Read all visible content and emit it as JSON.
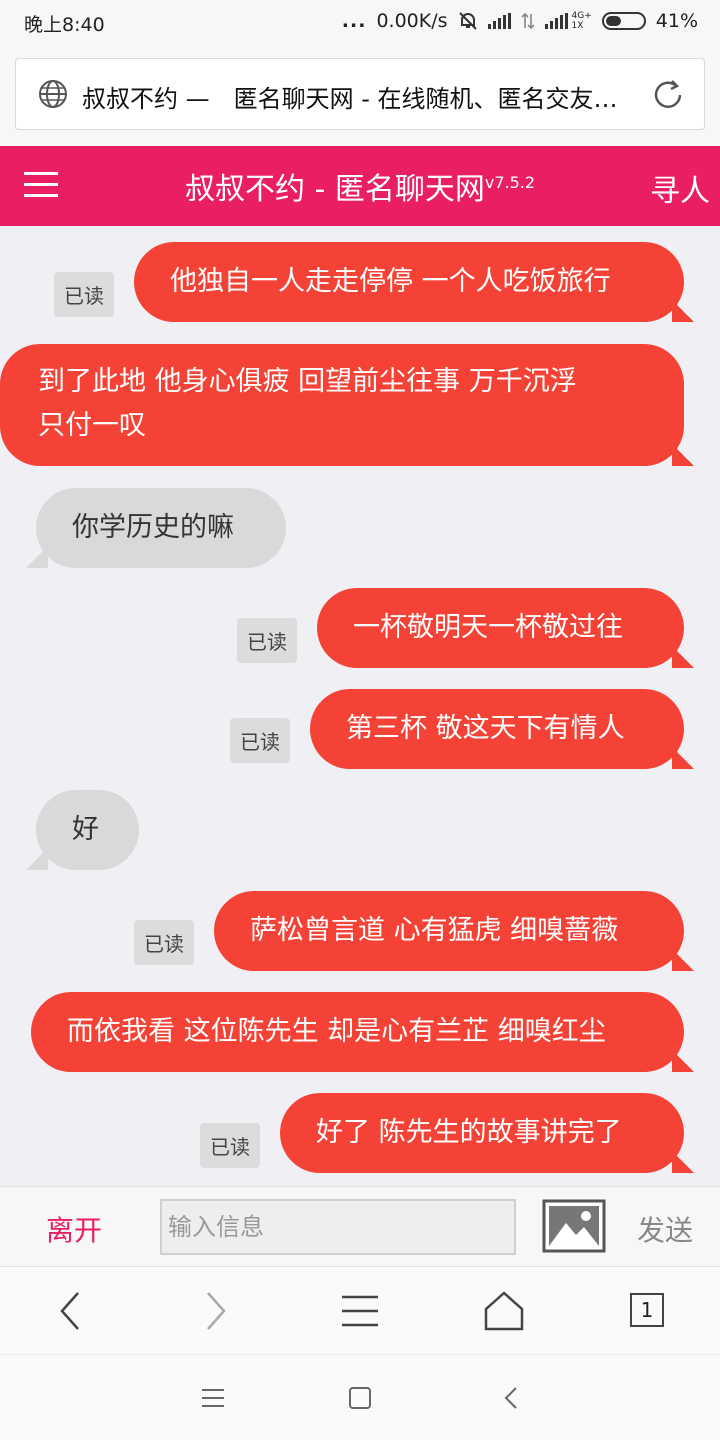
{
  "status_bar": {
    "time": "晚上8:40",
    "dots": "...",
    "net_speed": "0.00K/s",
    "network_label_top": "4G+",
    "network_label_bottom": "1X",
    "battery": "41%",
    "battery_level": 0.41
  },
  "address_bar": {
    "url_text": "叔叔不约 —　匿名聊天网 - 在线随机、匿名交友…",
    "globe_icon": "globe-icon",
    "reload_icon": "reload-icon"
  },
  "header": {
    "menu_icon": "hamburger-icon",
    "title": "叔叔不约 - 匿名聊天网",
    "version": "v7.5.2",
    "find_label": "寻人",
    "color": "#e91e63"
  },
  "messages": [
    {
      "dir": "out",
      "text": "他独自一人走走停停 一个人吃饭旅行",
      "read": "已读"
    },
    {
      "dir": "out",
      "line1": "到了此地 他身心俱疲 回望前尘往事 万千沉浮",
      "line2": "只付一叹"
    },
    {
      "dir": "in",
      "text": "你学历史的嘛"
    },
    {
      "dir": "out",
      "text": "一杯敬明天一杯敬过往",
      "read": "已读"
    },
    {
      "dir": "out",
      "text": "第三杯 敬这天下有情人",
      "read": "已读"
    },
    {
      "dir": "in",
      "text": "好"
    },
    {
      "dir": "out",
      "text": "萨松曾言道 心有猛虎 细嗅蔷薇",
      "read": "已读"
    },
    {
      "dir": "out",
      "text": "而依我看 这位陈先生 却是心有兰芷 细嗅红尘"
    },
    {
      "dir": "out",
      "text": "好了 陈先生的故事讲完了",
      "read": "已读"
    }
  ],
  "input_bar": {
    "leave_label": "离开",
    "placeholder": "输入信息",
    "image_icon": "image-icon",
    "send_label": "发送"
  },
  "browser_nav": {
    "back_icon": "back-arrow-icon",
    "forward_icon": "forward-arrow-icon",
    "menu_icon": "menu-icon",
    "home_icon": "home-icon",
    "tab_count": "1"
  },
  "colors": {
    "accent": "#e91e63",
    "outgoing_bubble": "#f44336",
    "incoming_bubble": "#d9d9d9"
  }
}
